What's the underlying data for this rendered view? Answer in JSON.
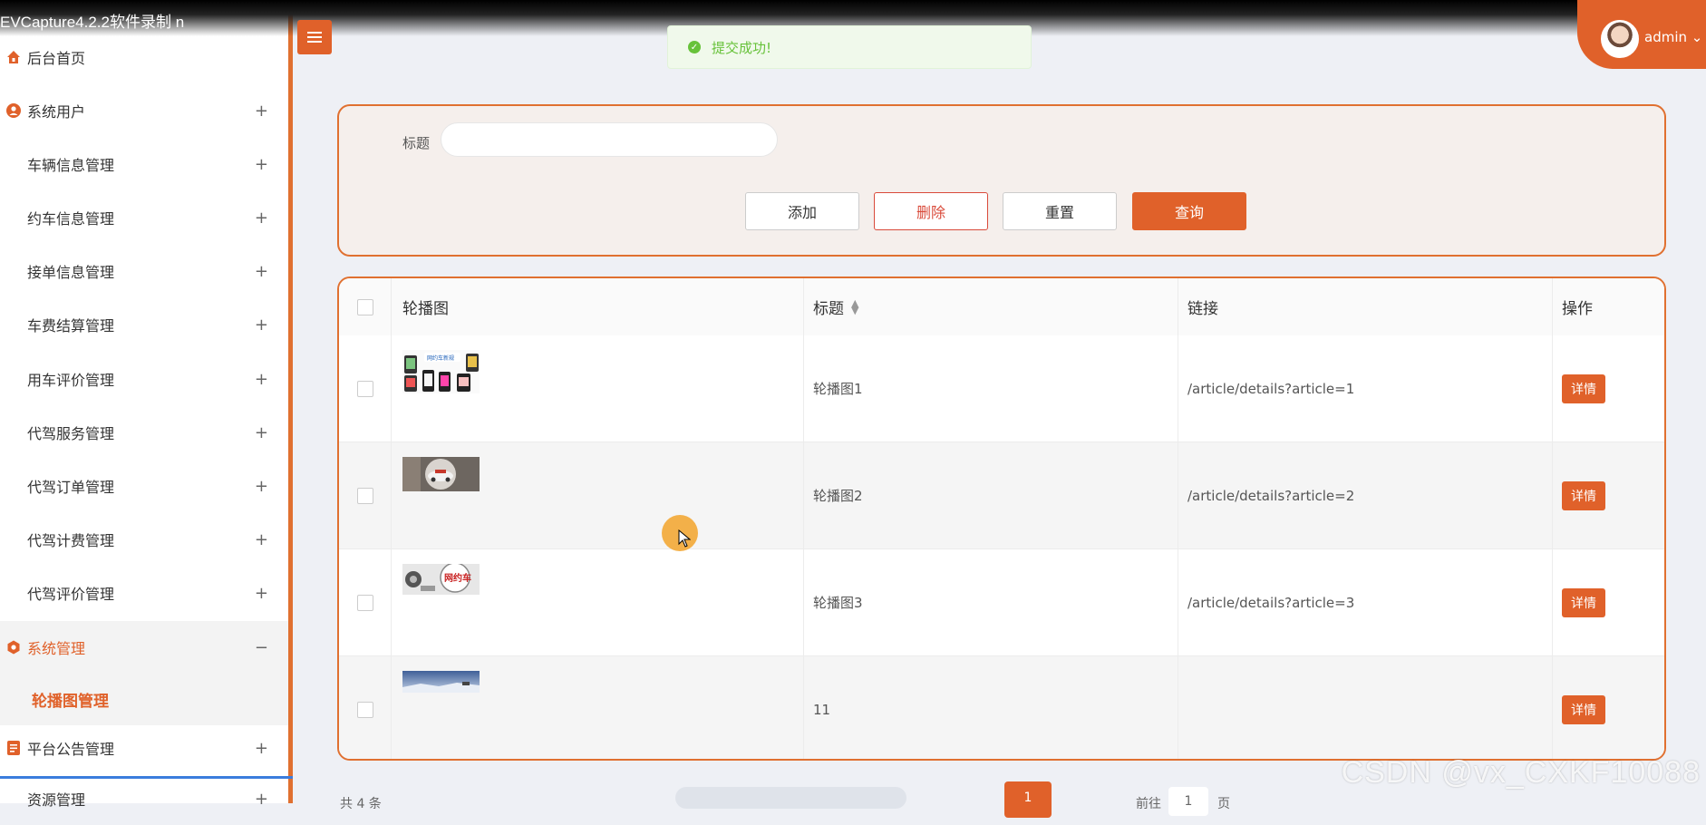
{
  "recorder": {
    "title": "EVCapture4.2.2软件录制 n",
    "corner_icon": "expand-icon"
  },
  "sidebar": {
    "items": [
      {
        "label": "后台首页",
        "icon": "home-icon",
        "expand": ""
      },
      {
        "label": "系统用户",
        "icon": "user-icon",
        "expand": "+"
      },
      {
        "label": "车辆信息管理",
        "icon": "grid-icon",
        "expand": "+"
      },
      {
        "label": "约车信息管理",
        "icon": "grid-icon",
        "expand": "+"
      },
      {
        "label": "接单信息管理",
        "icon": "grid-icon",
        "expand": "+"
      },
      {
        "label": "车费结算管理",
        "icon": "grid-icon",
        "expand": "+"
      },
      {
        "label": "用车评价管理",
        "icon": "grid-icon",
        "expand": "+"
      },
      {
        "label": "代驾服务管理",
        "icon": "grid-icon",
        "expand": "+"
      },
      {
        "label": "代驾订单管理",
        "icon": "grid-icon",
        "expand": "+"
      },
      {
        "label": "代驾计费管理",
        "icon": "grid-icon",
        "expand": "+"
      },
      {
        "label": "代驾评价管理",
        "icon": "grid-icon",
        "expand": "+"
      },
      {
        "label": "系统管理",
        "icon": "gear-icon",
        "expand": "−"
      },
      {
        "label": "平台公告管理",
        "icon": "doc-icon",
        "expand": "+"
      },
      {
        "label": "资源管理",
        "icon": "grid-icon",
        "expand": "+"
      }
    ],
    "sub_item": "轮播图管理"
  },
  "header": {
    "toast": "提交成功!",
    "user": "admin",
    "user_caret": "⌄"
  },
  "search": {
    "label": "标题",
    "value": "",
    "buttons": {
      "add": "添加",
      "delete": "删除",
      "reset": "重置",
      "query": "查询"
    }
  },
  "table": {
    "headers": {
      "image": "轮播图",
      "title": "标题",
      "link": "链接",
      "op": "操作"
    },
    "rows": [
      {
        "title": "轮播图1",
        "link": "/article/details?article=1",
        "action": "详情"
      },
      {
        "title": "轮播图2",
        "link": "/article/details?article=2",
        "action": "详情"
      },
      {
        "title": "轮播图3",
        "link": "/article/details?article=3",
        "action": "详情"
      },
      {
        "title": "11",
        "link": "",
        "action": "详情"
      }
    ]
  },
  "pagination": {
    "total": "共 4 条",
    "current_page": "1",
    "goto_label": "前往",
    "goto_value": "1",
    "page_unit": "页"
  },
  "watermark": "CSDN @vx_CXKF10088",
  "colors": {
    "accent": "#e0612a",
    "success": "#67c23a",
    "danger": "#d94a3a"
  }
}
